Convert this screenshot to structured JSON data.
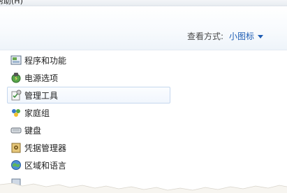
{
  "menubar": {
    "help": "帮助(H)"
  },
  "view_by": {
    "label": "查看方式:",
    "value": "小图标"
  },
  "items": [
    {
      "label": "程序和功能",
      "icon": "programs-features-icon"
    },
    {
      "label": "电源选项",
      "icon": "power-options-icon"
    },
    {
      "label": "管理工具",
      "icon": "admin-tools-icon",
      "selected": true
    },
    {
      "label": "家庭组",
      "icon": "homegroup-icon"
    },
    {
      "label": "键盘",
      "icon": "keyboard-icon"
    },
    {
      "label": "凭据管理器",
      "icon": "credential-manager-icon"
    },
    {
      "label": "区域和语言",
      "icon": "region-language-icon"
    },
    {
      "label": "",
      "icon": "partially-visible-item-icon"
    }
  ]
}
